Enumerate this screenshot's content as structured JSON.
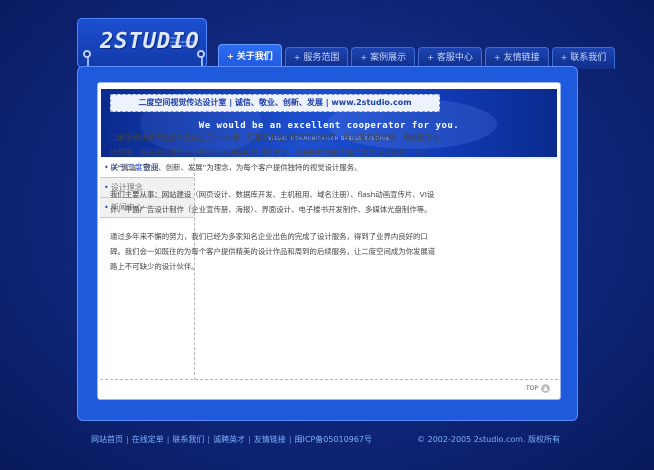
{
  "logo": {
    "text": "2STUDIO",
    "tagline": "VISUAL COMMUNICATION DESIGN STUDIO"
  },
  "nav": {
    "tabs": [
      {
        "label": "关于我们",
        "active": true
      },
      {
        "label": "服务范围",
        "active": false
      },
      {
        "label": "案例展示",
        "active": false
      },
      {
        "label": "客服中心",
        "active": false
      },
      {
        "label": "友情链接",
        "active": false
      },
      {
        "label": "联系我们",
        "active": false
      }
    ],
    "bullet": "+"
  },
  "banner": {
    "headline": "We would be an excellent cooperator for you.",
    "subline": "VISUAL COMMUNICATION DESIGN STUDIOS"
  },
  "sidebar": {
    "items": [
      {
        "label": "关于二度空间",
        "active": true
      },
      {
        "label": "设计理念",
        "active": false
      },
      {
        "label": "新闻中心",
        "active": false
      }
    ]
  },
  "content": {
    "slogan": "二度空间视觉传达设计室 | 诚信、敬业、创新、发展 | www.2studio.com",
    "paragraphs": [
      "二度空间视觉传达设计室成立于2002年，汇集有多名资深网页设计师、专业美术设计师、高级程序设计师等，具有高水准的设计理念和突破陈规的创意思维、高超的技术能力和丰富的设计经验，我们以“诚信、敬业、创新、发展”为理念，为每个客户提供独特的视觉设计服务。",
      "我们主要从事：网站建设（网页设计、数据库开发、主机租用、域名注册）、flash动画宣传片、VI设计、平面广告设计制作（企业宣传册、海报）、界面设计、电子楼书开发制作、多媒体光盘制作等。",
      "通过多年来不懈的努力，我们已经为多家知名企业出色的完成了设计服务，得到了业界内良好的口碑。我们会一如既往的为每个客户提供精美的设计作品和周到的后续服务，让二度空间成为你发展道路上不可缺少的设计伙伴。"
    ]
  },
  "top_link": {
    "label": "TOP",
    "icon": "arrow-up-icon"
  },
  "footer": {
    "links": [
      "网站首页",
      "在线定单",
      "联系我们",
      "诚聘英才",
      "友情链接",
      "闽ICP备05010967号"
    ],
    "separator": "|",
    "copyright": "© 2002-2005 2studio.com. 版权所有"
  },
  "colors": {
    "background": "#0f2679",
    "frame": "#1f59dc",
    "active_tab": "#2d6df0",
    "link": "#7fb0ff",
    "accent": "#1d4fd3"
  }
}
